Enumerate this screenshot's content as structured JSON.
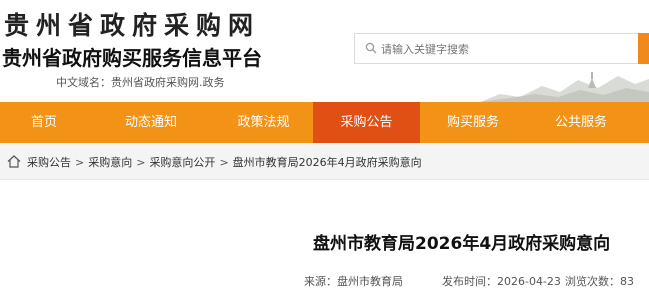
{
  "header": {
    "site_title": "贵州省政府采购网",
    "site_subtitle": "贵州省政府购买服务信息平台",
    "domain_label": "中文域名：贵州省政府采购网.政务"
  },
  "search": {
    "placeholder": "请输入关键字搜索"
  },
  "nav": {
    "items": [
      {
        "label": "首页"
      },
      {
        "label": "动态通知"
      },
      {
        "label": "政策法规"
      },
      {
        "label": "采购公告"
      },
      {
        "label": "购买服务"
      },
      {
        "label": "公共服务"
      }
    ],
    "active_index": 3
  },
  "breadcrumb": {
    "items": [
      "采购公告",
      "采购意向",
      "采购意向公开",
      "盘州市教育局2026年4月政府采购意向"
    ],
    "separator": ">"
  },
  "article": {
    "title": "盘州市教育局2026年4月政府采购意向",
    "source": "来源：盘州市教育局",
    "publish_time": "发布时间：2026-04-23",
    "views": "浏览次数：83"
  },
  "colors": {
    "nav_bg": "#f29216",
    "nav_active": "#e04f13",
    "search_button": "#f08a1d"
  },
  "icons": [
    "search-icon",
    "home-icon",
    "mountain-landscape"
  ]
}
